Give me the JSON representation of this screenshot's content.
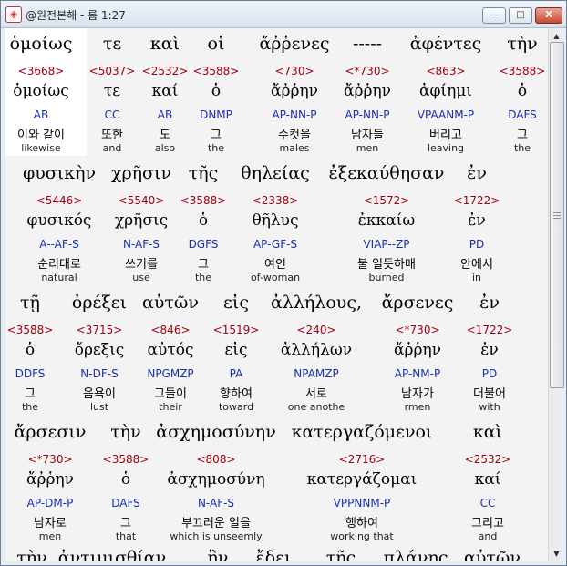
{
  "window": {
    "title": "@원전본해 - 롬 1:27",
    "minimize": "—",
    "maximize": "□",
    "close": "X"
  },
  "verses": [
    {
      "greek": [
        "ὁμοίως",
        "τε",
        "καὶ",
        "οἱ",
        "ἄῤῥενες",
        "-----",
        "ἀφέντες",
        "τὴν"
      ],
      "strong": [
        "<3668>",
        "<5037>",
        "<2532>",
        "<3588>",
        "<730>",
        "<*730>",
        "<863>",
        "<3588>"
      ],
      "lemma": [
        "ὁμοίως",
        "τε",
        "καί",
        "ὁ",
        "ἄῤῥην",
        "ἄῤῥην",
        "ἀφίημι",
        "ὁ"
      ],
      "parse": [
        "AB",
        "CC",
        "AB",
        "DNMP",
        "AP-NN-P",
        "AP-NN-P",
        "VPAANM-P",
        "DAFS"
      ],
      "korean": [
        "이와 같이",
        "또한",
        "도",
        "그",
        "수컷을",
        "남자들",
        "버리고",
        "그"
      ],
      "english": [
        "likewise",
        "and",
        "also",
        "the",
        "males",
        "men",
        "leaving",
        "the"
      ]
    },
    {
      "greek": [
        "φυσικὴν",
        "χρῆσιν",
        "τῆς",
        "θηλείας",
        "ἐξεκαύθησαν",
        "ἐν"
      ],
      "strong": [
        "<5446>",
        "<5540>",
        "<3588>",
        "<2338>",
        "<1572>",
        "<1722>"
      ],
      "lemma": [
        "φυσικός",
        "χρῆσις",
        "ὁ",
        "θῆλυς",
        "ἐκκαίω",
        "ἐν"
      ],
      "parse": [
        "A--AF-S",
        "N-AF-S",
        "DGFS",
        "AP-GF-S",
        "VIAP--ZP",
        "PD"
      ],
      "korean": [
        "순리대로",
        "쓰기를",
        "그",
        "여인",
        "불 일듯하매",
        "안에서"
      ],
      "english": [
        "natural",
        "use",
        "the",
        "of-woman",
        "burned",
        "in"
      ]
    },
    {
      "greek": [
        "τῇ",
        "ὀρέξει",
        "αὐτῶν",
        "εἰς",
        "ἀλλήλους,",
        "ἄρσενες",
        "ἐν"
      ],
      "strong": [
        "<3588>",
        "<3715>",
        "<846>",
        "<1519>",
        "<240>",
        "<*730>",
        "<1722>"
      ],
      "lemma": [
        "ὁ",
        "ὄρεξις",
        "αὐτός",
        "εἰς",
        "ἀλλήλων",
        "ἄῤῥην",
        "ἐν"
      ],
      "parse": [
        "DDFS",
        "N-DF-S",
        "NPGMZP",
        "PA",
        "NPAMZP",
        "AP-NM-P",
        "PD"
      ],
      "korean": [
        "그",
        "음욕이",
        "그들이",
        "향하여",
        "서로",
        "남자가",
        "더불어"
      ],
      "english": [
        "the",
        "lust",
        "their",
        "toward",
        "one anothe",
        "rmen",
        "with"
      ]
    },
    {
      "greek": [
        "ἄρσεσιν",
        "τὴν",
        "ἀσχημοσύνην",
        "κατεργαζόμενοι",
        "καὶ"
      ],
      "strong": [
        "<*730>",
        "<3588>",
        "<808>",
        "<2716>",
        "<2532>"
      ],
      "lemma": [
        "ἄῤῥην",
        "ὁ",
        "ἀσχημοσύνη",
        "κατεργάζομαι",
        "καί"
      ],
      "parse": [
        "AP-DM-P",
        "DAFS",
        "N-AF-S",
        "VPPNNM-P",
        "CC"
      ],
      "korean": [
        "남자로",
        "그",
        "부끄러운 일을",
        "행하여",
        "그리고"
      ],
      "english": [
        "men",
        "that",
        "which is unseemly",
        "working that",
        "and"
      ]
    },
    {
      "greek": [
        "τὴν",
        "ἀντιμισθίαν",
        "ἣν",
        "ἔδει",
        "τῆς",
        "πλάνης",
        "αὐτῶν"
      ],
      "strong": [],
      "lemma": [],
      "parse": [],
      "korean": [],
      "english": []
    }
  ]
}
